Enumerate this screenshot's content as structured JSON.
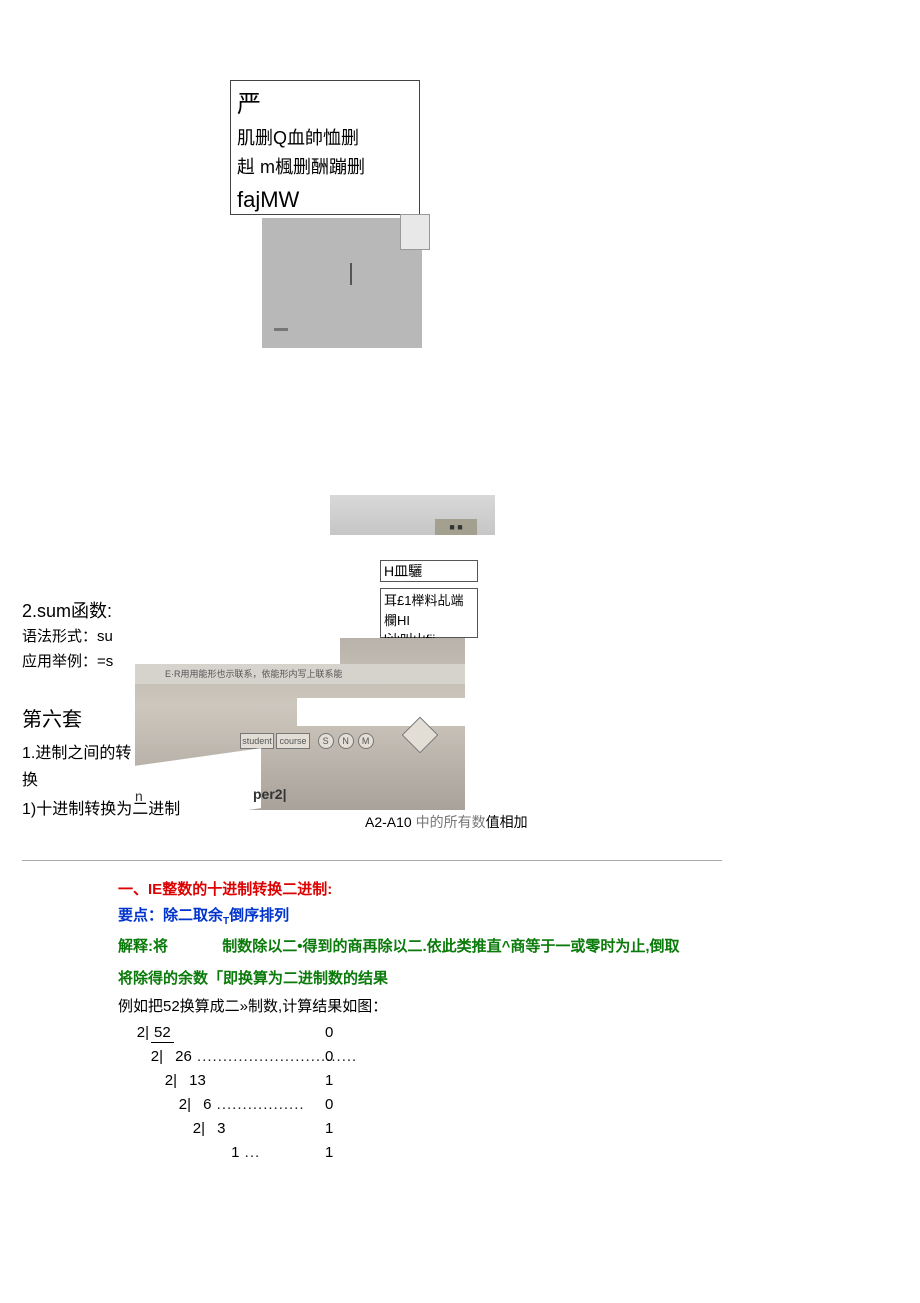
{
  "box1": {
    "l1": "严",
    "l2": " 肌删Q血帥恤删",
    "l3": "赳 m楓删酬蹦删",
    "l4": "fajMW"
  },
  "photo2_tab": "■ ■",
  "box2": "H皿驪",
  "box3": {
    "l1": "耳£1榉料乩端欄HI",
    "l2": "l汕叫山fii"
  },
  "sum": {
    "title": "2.sum函数:",
    "l1": "语法形式：su",
    "l2": "应用举例：=s"
  },
  "photo3": {
    "strip": "E·R用用能形也示联系，依能形内写上联系能",
    "rect_a": "student",
    "rect_b": "course",
    "c1": "S",
    "c2": "N",
    "c3": "M",
    "n": "n",
    "per2": "per2|"
  },
  "set6": "第六套",
  "conv_t": "1.进制之间的转换",
  "conv_1": "1)十进制转换为二进制",
  "a2a10_pre": "A2-A10 ",
  "a2a10_mid": "中的所有数",
  "a2a10_post": "值相加",
  "red1_pre": "一、",
  "red1_ie": "IE",
  "red1_post": "整数的十进制转换二进制:",
  "blue1_pre": "要点：除二取余",
  "blue1_sub": "T",
  "blue1_post": "倒序排列",
  "green1_a": "解释:将",
  "green1_b": "制数除以二•得到的商再除以二.依此类推直^商等于一或零时为止,倒取",
  "green2": "将除得的余数「即换算为二进制数的结果",
  "ex1": "例如把52换算成二»制数,计算结果如图：",
  "calc": {
    "rows": [
      {
        "indent": 0,
        "two": "2|",
        "val": "52",
        "bar": true,
        "dots": false,
        "res": "0"
      },
      {
        "indent": 14,
        "two": "2|",
        "val": "26",
        "bar": false,
        "dots": true,
        "res": "0"
      },
      {
        "indent": 28,
        "two": "2|",
        "val": "13",
        "bar": false,
        "dots": false,
        "res": "1"
      },
      {
        "indent": 42,
        "two": "2|",
        "val": "6",
        "bar": false,
        "dots": true,
        "res": "0"
      },
      {
        "indent": 56,
        "two": "2|",
        "val": "3",
        "bar": false,
        "dots": false,
        "res": "1"
      },
      {
        "indent": 70,
        "two": "",
        "val": "1",
        "bar": false,
        "dots": true,
        "res": "1"
      }
    ]
  }
}
